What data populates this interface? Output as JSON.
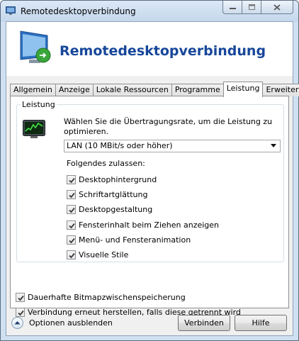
{
  "window": {
    "title": "Remotedesktopverbindung"
  },
  "banner": {
    "title": "Remotedesktopverbindung"
  },
  "tabs": [
    {
      "label": "Allgemein"
    },
    {
      "label": "Anzeige"
    },
    {
      "label": "Lokale Ressourcen"
    },
    {
      "label": "Programme"
    },
    {
      "label": "Leistung"
    },
    {
      "label": "Erweitert"
    }
  ],
  "active_tab": "Leistung",
  "performance": {
    "group_label": "Leistung",
    "description": "Wählen Sie die Übertragungsrate, um die Leistung zu optimieren.",
    "speed_select": {
      "value": "LAN (10 MBit/s oder höher)"
    },
    "allow_label": "Folgendes zulassen:",
    "options": [
      {
        "label": "Desktophintergrund",
        "checked": true
      },
      {
        "label": "Schriftartglättung",
        "checked": true
      },
      {
        "label": "Desktopgestaltung",
        "checked": true
      },
      {
        "label": "Fensterinhalt beim Ziehen anzeigen",
        "checked": true
      },
      {
        "label": "Menü- und Fensteranimation",
        "checked": true
      },
      {
        "label": "Visuelle Stile",
        "checked": true
      }
    ]
  },
  "extra_options": [
    {
      "label": "Dauerhafte Bitmapzwischenspeicherung",
      "checked": true
    },
    {
      "label": "Verbindung erneut herstellen, falls diese getrennt wird",
      "checked": true
    }
  ],
  "footer": {
    "options_toggle": "Optionen ausblenden",
    "connect_button": "Verbinden",
    "help_button": "Hilfe"
  }
}
